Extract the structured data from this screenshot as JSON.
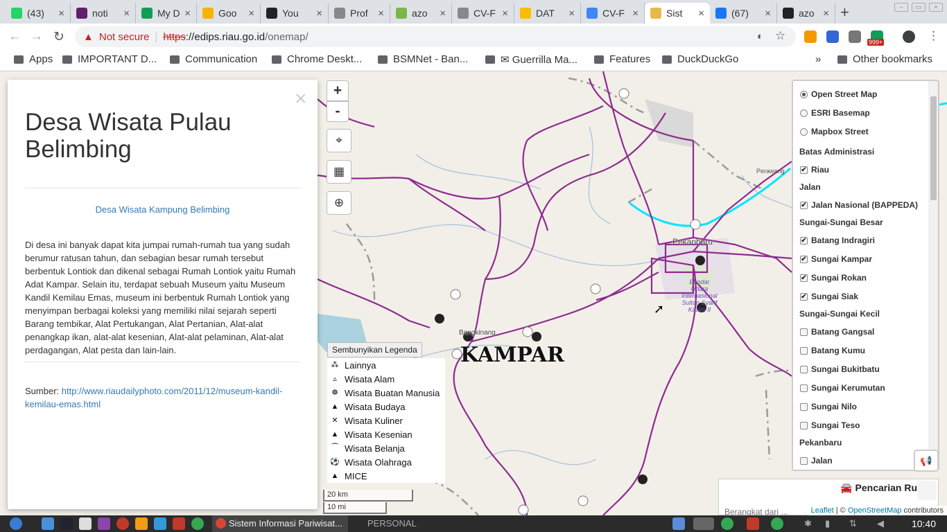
{
  "browser": {
    "tabs": [
      {
        "label": "(43)",
        "color": "#25d366",
        "icon": "whatsapp-icon"
      },
      {
        "label": "noti",
        "color": "#611f69",
        "icon": "slack-icon"
      },
      {
        "label": "My D",
        "color": "#0f9d58",
        "icon": "sheets-icon"
      },
      {
        "label": "Goo",
        "color": "#f4b400",
        "icon": "keep-icon"
      },
      {
        "label": "You",
        "color": "#222222",
        "icon": "spotify-icon"
      },
      {
        "label": "Prof",
        "color": "#888888",
        "icon": "page-icon"
      },
      {
        "label": "azo",
        "color": "#7ab648",
        "icon": "extension-icon"
      },
      {
        "label": "CV-F",
        "color": "#888888",
        "icon": "page-icon"
      },
      {
        "label": "DAT",
        "color": "#fbbc04",
        "icon": "drive-icon"
      },
      {
        "label": "CV-F",
        "color": "#4285f4",
        "icon": "docs-icon"
      },
      {
        "label": "Sist",
        "color": "#e8b94a",
        "icon": "site-icon"
      },
      {
        "label": "(67)",
        "color": "#1877f2",
        "icon": "facebook-icon"
      },
      {
        "label": "azo",
        "color": "#222222",
        "icon": "github-icon"
      }
    ],
    "new_tab": "+",
    "security": "Not secure",
    "url_scheme": "https",
    "url_host": "://edips.riau.go.id",
    "url_path": "/onemap/",
    "bookmarks": [
      "Apps",
      "IMPORTANT D...",
      "Communication",
      "Chrome Deskt...",
      "BSMNet - Ban...",
      "✉ Guerrilla Ma...",
      "Features",
      "DuckDuckGo"
    ],
    "more": "»",
    "other_bookmarks": "Other bookmarks",
    "badge": "999+"
  },
  "popup": {
    "title": "Desa Wisata Pulau Belimbing",
    "close": "×",
    "image_alt": "Desa Wisata Kampung Belimbing",
    "description": "Di desa ini banyak dapat kita jumpai rumah-rumah tua yang sudah berumur ratusan tahun, dan sebagian besar rumah tersebut berbentuk Lontiok dan dikenal sebagai Rumah Lontiok yaitu Rumah Adat Kampar. Selain itu, terdapat sebuah Museum yaitu Museum Kandil Kemilau Emas, museum ini berbentuk Rumah Lontiok yang menyimpan berbagai koleksi yang memiliki nilai sejarah seperti Barang tembikar, Alat Pertukangan, Alat Pertanian, Alat-alat penangkap ikan, alat-alat kesenian, Alat-alat pelaminan, Alat-alat perdagangan, Alat pesta dan lain-lain.",
    "source_label": "Sumber: ",
    "source_link": "http://www.riaudailyphoto.com/2011/12/museum-kandil-kemilau-emas.html"
  },
  "map": {
    "zoom_in": "+",
    "zoom_out": "-",
    "region_label": "KAMPAR",
    "city_label": "Pekanbaru",
    "town_label": "Bangkinang",
    "airport_label": "Bandar Udara Internasional Sultan Syarif Kasim II",
    "place_label": "Perawang",
    "legend_toggle": "Sembunyikan Legenda",
    "legend": [
      "Lainnya",
      "Wisata Alam",
      "Wisata Buatan Manusia",
      "Wisata Budaya",
      "Wisata Kuliner",
      "Wisata Kesenian",
      "Wisata Belanja",
      "Wisata Olahraga",
      "MICE"
    ],
    "scale_km": "20 km",
    "scale_mi": "10 mi"
  },
  "layers": {
    "basemaps": [
      {
        "label": "Open Street Map",
        "selected": true
      },
      {
        "label": "ESRI Basemap",
        "selected": false
      },
      {
        "label": "Mapbox Street",
        "selected": false
      }
    ],
    "groups": [
      {
        "title": "Batas Administrasi",
        "items": [
          {
            "label": "Riau",
            "checked": true
          }
        ]
      },
      {
        "title": "Jalan",
        "items": [
          {
            "label": "Jalan Nasional (BAPPEDA)",
            "checked": true
          }
        ]
      },
      {
        "title": "Sungai-Sungai Besar",
        "items": [
          {
            "label": "Batang Indragiri",
            "checked": true
          },
          {
            "label": "Sungai Kampar",
            "checked": true
          },
          {
            "label": "Sungai Rokan",
            "checked": true
          },
          {
            "label": "Sungai Siak",
            "checked": true
          }
        ]
      },
      {
        "title": "Sungai-Sungai Kecil",
        "items": [
          {
            "label": "Batang Gangsal",
            "checked": false
          },
          {
            "label": "Batang Kumu",
            "checked": false
          },
          {
            "label": "Sungai Bukitbatu",
            "checked": false
          },
          {
            "label": "Sungai Kerumutan",
            "checked": false
          },
          {
            "label": "Sungai Nilo",
            "checked": false
          },
          {
            "label": "Sungai Teso",
            "checked": false
          }
        ]
      },
      {
        "title": "Pekanbaru",
        "items": [
          {
            "label": "Jalan",
            "checked": false
          }
        ]
      }
    ]
  },
  "search": {
    "title": "Pencarian Ru",
    "placeholder": "Berangkat dari ..."
  },
  "attribution": {
    "leaflet": "Leaflet",
    "sep": " | © ",
    "osm": "OpenStreetMap",
    "suffix": " contributors"
  },
  "taskbar": {
    "window": "Sistem Informasi Pariwisat...",
    "workspace": "PERSONAL",
    "clock": "10:40"
  },
  "colors": {
    "road": "#8e2b8e",
    "river": "#00e5ff",
    "link": "#337ab7"
  }
}
